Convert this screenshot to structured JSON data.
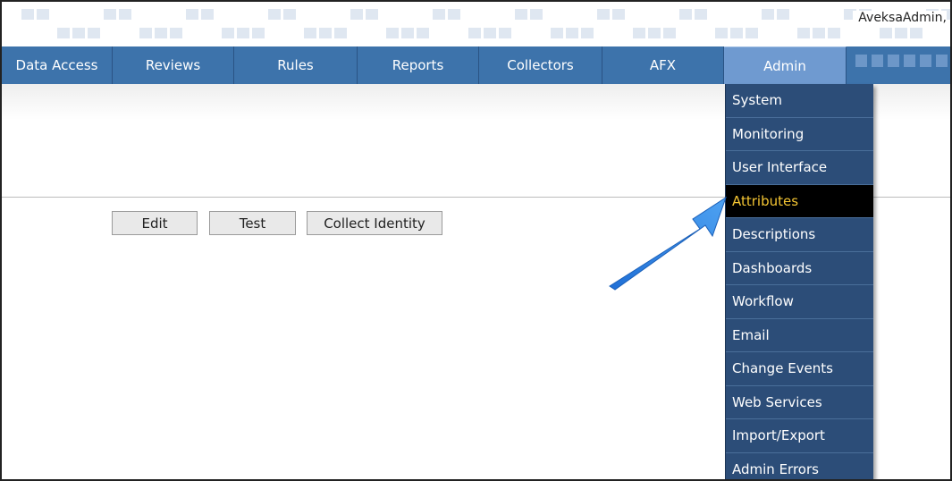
{
  "header": {
    "user_label": "AveksaAdmin,"
  },
  "nav": {
    "items": [
      {
        "label": "Data Access"
      },
      {
        "label": "Reviews"
      },
      {
        "label": "Rules"
      },
      {
        "label": "Reports"
      },
      {
        "label": "Collectors"
      },
      {
        "label": "AFX"
      },
      {
        "label": "Admin",
        "active": true
      }
    ]
  },
  "actions": {
    "edit_label": "Edit",
    "test_label": "Test",
    "collect_identity_label": "Collect Identity"
  },
  "admin_menu": {
    "items": [
      {
        "label": "System"
      },
      {
        "label": "Monitoring"
      },
      {
        "label": "User Interface"
      },
      {
        "label": "Attributes",
        "highlighted": true
      },
      {
        "label": "Descriptions"
      },
      {
        "label": "Dashboards"
      },
      {
        "label": "Workflow"
      },
      {
        "label": "Email"
      },
      {
        "label": "Change Events"
      },
      {
        "label": "Web Services"
      },
      {
        "label": "Import/Export"
      },
      {
        "label": "Admin Errors"
      }
    ]
  },
  "colors": {
    "nav_bg": "#3d73ab",
    "nav_active": "#6f9ad0",
    "menu_bg": "#2c4d78",
    "menu_highlight_bg": "#000000",
    "menu_highlight_text": "#f4c533",
    "annotation_arrow": "#2f86e6"
  },
  "annotation": {
    "icon": "pointer-arrow-icon"
  }
}
